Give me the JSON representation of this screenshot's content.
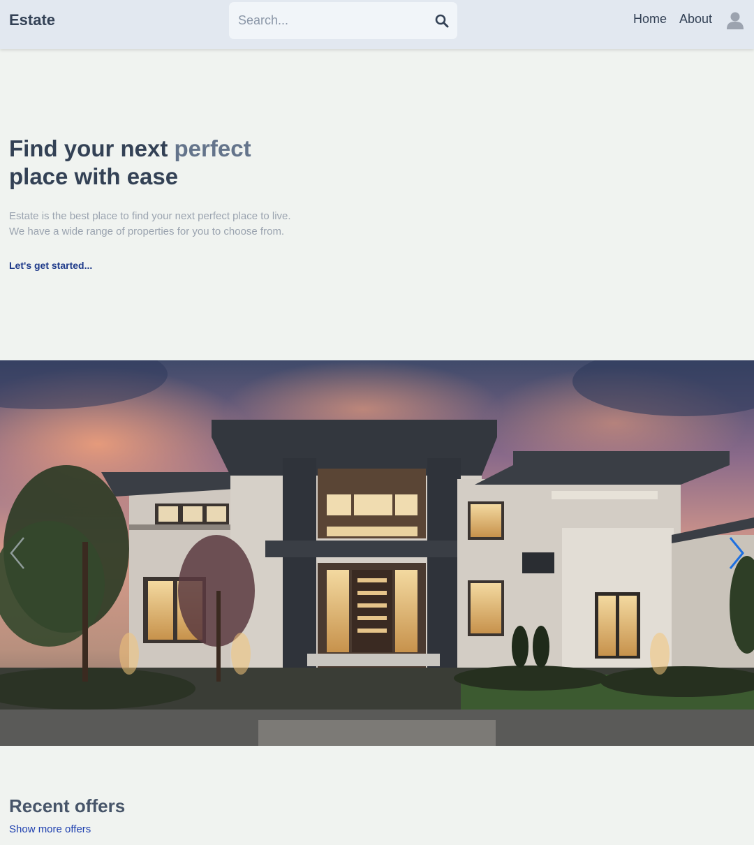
{
  "header": {
    "logo": "Estate",
    "search": {
      "placeholder": "Search...",
      "value": ""
    },
    "nav": {
      "home": "Home",
      "about": "About"
    }
  },
  "hero": {
    "title_part1": "Find your next ",
    "title_accent": "perfect",
    "title_part2": "place with ease",
    "description_line1": "Estate is the best place to find your next perfect place to live.",
    "description_line2": "We have a wide range of properties for you to choose from.",
    "cta": "Let's get started..."
  },
  "slider": {
    "image": "modern-house-at-dusk",
    "arrow_color": "#1d6fe0"
  },
  "offers": {
    "title": "Recent offers",
    "link": "Show more offers"
  },
  "colors": {
    "page_bg": "#f0f3f0",
    "header_bg": "#e2e8f0",
    "text_dark": "#334155",
    "text_accent": "#64748b",
    "link": "#1e3a8a"
  }
}
